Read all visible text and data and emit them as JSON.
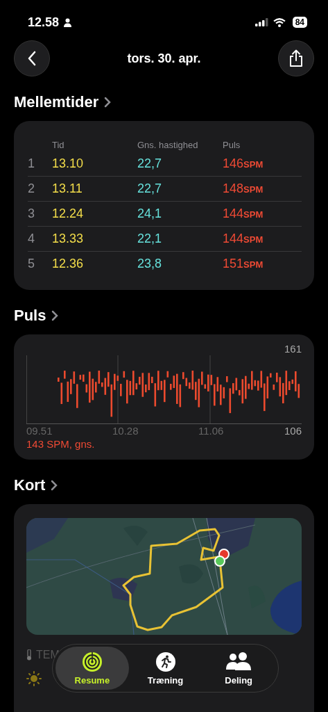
{
  "status_bar": {
    "time": "12.58",
    "battery": "84"
  },
  "header": {
    "title": "tors. 30. apr."
  },
  "splits": {
    "title": "Mellemtider",
    "columns": [
      "Tid",
      "Gns. hastighed",
      "Puls"
    ],
    "rows": [
      {
        "index": "1",
        "time": "13.10",
        "speed": "22,7",
        "pulse": "146",
        "unit": "SPM"
      },
      {
        "index": "2",
        "time": "13.11",
        "speed": "22,7",
        "pulse": "148",
        "unit": "SPM"
      },
      {
        "index": "3",
        "time": "12.24",
        "speed": "24,1",
        "pulse": "144",
        "unit": "SPM"
      },
      {
        "index": "4",
        "time": "13.33",
        "speed": "22,1",
        "pulse": "144",
        "unit": "SPM"
      },
      {
        "index": "5",
        "time": "12.36",
        "speed": "23,8",
        "pulse": "151",
        "unit": "SPM"
      }
    ]
  },
  "heart_rate": {
    "title": "Puls",
    "max": "161",
    "min": "106",
    "x_labels": [
      "09.51",
      "10.28",
      "11.06"
    ],
    "average": "143 SPM, gns."
  },
  "map": {
    "title": "Kort",
    "kind": "picture"
  },
  "weather": {
    "label": "TEM"
  },
  "tab_bar": [
    {
      "label": "Resume",
      "selected": true
    },
    {
      "label": "Træning",
      "selected": false
    },
    {
      "label": "Deling",
      "selected": false
    }
  ]
}
